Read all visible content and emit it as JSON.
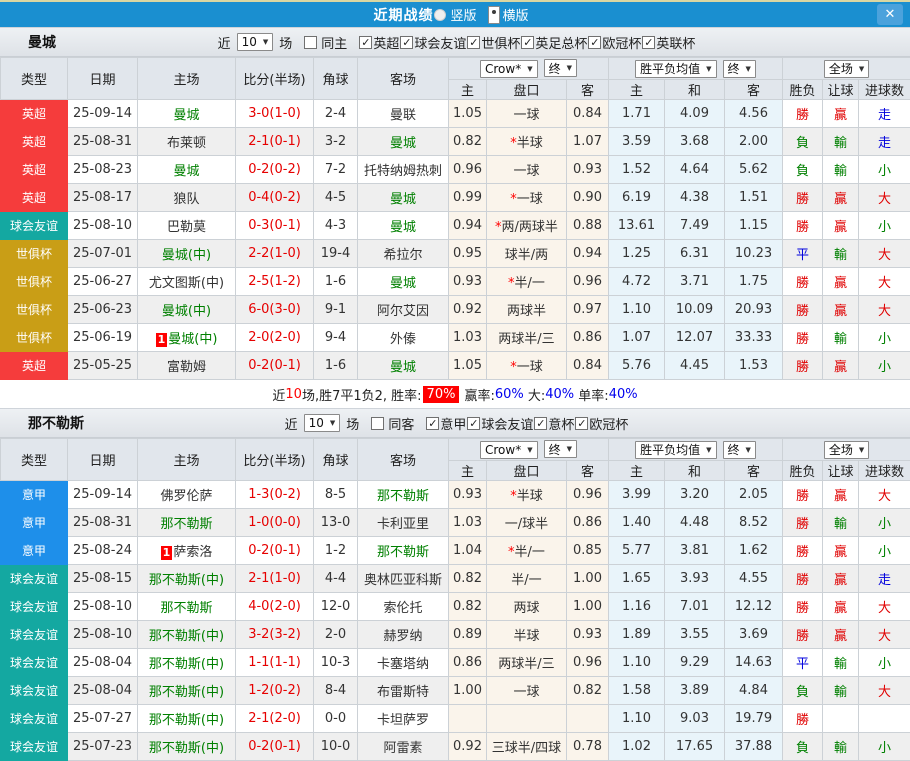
{
  "titlebar": {
    "title": "近期战绩",
    "radios": [
      {
        "label": "竖版",
        "selected": false
      },
      {
        "label": "横版",
        "selected": true
      }
    ],
    "close_label": "✕"
  },
  "table_header": {
    "left": [
      "类型",
      "日期",
      "主场",
      "比分(半场)",
      "角球",
      "客场"
    ],
    "dropdowns": {
      "crow": "Crow*",
      "final1": "终",
      "avg": "胜平负均值",
      "final2": "终",
      "scope": "全场"
    },
    "sub": [
      "主",
      "盘口",
      "客",
      "主",
      "和",
      "客",
      "胜负",
      "让球",
      "进球数"
    ]
  },
  "colors": {
    "accent_blue": "#1a8fd0",
    "type_epl": "#f53c3c",
    "type_friendly": "#14a8a1",
    "type_cwc": "#c99e16",
    "type_seriea": "#1e8fea",
    "win_red": "#e00000",
    "lose_green": "#008000",
    "draw_blue": "#0000dd"
  },
  "sections": [
    {
      "team": "曼城",
      "filter": {
        "near": "近",
        "count": "10",
        "games": "场",
        "same": {
          "label": "同主",
          "checked": false
        },
        "leagues": [
          {
            "label": "英超",
            "checked": true
          },
          {
            "label": "球会友谊",
            "checked": true
          },
          {
            "label": "世俱杯",
            "checked": true
          },
          {
            "label": "英足总杯",
            "checked": true
          },
          {
            "label": "欧冠杯",
            "checked": true
          },
          {
            "label": "英联杯",
            "checked": true
          }
        ]
      },
      "rows": [
        {
          "type": "英超",
          "type_c": "epl",
          "date": "25-09-14",
          "home": "曼城",
          "home_green": true,
          "home_badge": false,
          "score": "3-0",
          "half": "(1-0)",
          "corners": "2-4",
          "away": "曼联",
          "away_green": false,
          "o_home": "1.05",
          "h_star": false,
          "handicap": "一球",
          "o_away": "0.84",
          "avg_home": "1.71",
          "avg_draw": "4.09",
          "avg_away": "4.56",
          "res_wdl": "勝",
          "res_handicap": "贏",
          "res_goals": "走"
        },
        {
          "type": "英超",
          "type_c": "epl",
          "date": "25-08-31",
          "home": "布莱顿",
          "home_green": false,
          "home_badge": false,
          "score": "2-1",
          "half": "(0-1)",
          "corners": "3-2",
          "away": "曼城",
          "away_green": true,
          "o_home": "0.82",
          "h_star": true,
          "handicap": "半球",
          "o_away": "1.07",
          "avg_home": "3.59",
          "avg_draw": "3.68",
          "avg_away": "2.00",
          "res_wdl": "負",
          "res_handicap": "輸",
          "res_goals": "走"
        },
        {
          "type": "英超",
          "type_c": "epl",
          "date": "25-08-23",
          "home": "曼城",
          "home_green": true,
          "home_badge": false,
          "score": "0-2",
          "half": "(0-2)",
          "corners": "7-2",
          "away": "托特纳姆热刺",
          "away_green": false,
          "o_home": "0.96",
          "h_star": false,
          "handicap": "一球",
          "o_away": "0.93",
          "avg_home": "1.52",
          "avg_draw": "4.64",
          "avg_away": "5.62",
          "res_wdl": "負",
          "res_handicap": "輸",
          "res_goals": "小"
        },
        {
          "type": "英超",
          "type_c": "epl",
          "date": "25-08-17",
          "home": "狼队",
          "home_green": false,
          "home_badge": false,
          "score": "0-4",
          "half": "(0-2)",
          "corners": "4-5",
          "away": "曼城",
          "away_green": true,
          "o_home": "0.99",
          "h_star": true,
          "handicap": "一球",
          "o_away": "0.90",
          "avg_home": "6.19",
          "avg_draw": "4.38",
          "avg_away": "1.51",
          "res_wdl": "勝",
          "res_handicap": "贏",
          "res_goals": "大"
        },
        {
          "type": "球会友谊",
          "type_c": "friendly",
          "date": "25-08-10",
          "home": "巴勒莫",
          "home_green": false,
          "home_badge": false,
          "score": "0-3",
          "half": "(0-1)",
          "corners": "4-3",
          "away": "曼城",
          "away_green": true,
          "o_home": "0.94",
          "h_star": true,
          "handicap": "两/两球半",
          "o_away": "0.88",
          "avg_home": "13.61",
          "avg_draw": "7.49",
          "avg_away": "1.15",
          "res_wdl": "勝",
          "res_handicap": "贏",
          "res_goals": "小"
        },
        {
          "type": "世俱杯",
          "type_c": "cwc",
          "date": "25-07-01",
          "home": "曼城(中)",
          "home_green": true,
          "home_badge": false,
          "score": "2-2",
          "half": "(1-0)",
          "corners": "19-4",
          "away": "希拉尔",
          "away_green": false,
          "o_home": "0.95",
          "h_star": false,
          "handicap": "球半/两",
          "o_away": "0.94",
          "avg_home": "1.25",
          "avg_draw": "6.31",
          "avg_away": "10.23",
          "res_wdl": "平",
          "res_handicap": "輸",
          "res_goals": "大"
        },
        {
          "type": "世俱杯",
          "type_c": "cwc",
          "date": "25-06-27",
          "home": "尤文图斯(中)",
          "home_green": false,
          "home_badge": false,
          "score": "2-5",
          "half": "(1-2)",
          "corners": "1-6",
          "away": "曼城",
          "away_green": true,
          "o_home": "0.93",
          "h_star": true,
          "handicap": "半/一",
          "o_away": "0.96",
          "avg_home": "4.72",
          "avg_draw": "3.71",
          "avg_away": "1.75",
          "res_wdl": "勝",
          "res_handicap": "贏",
          "res_goals": "大"
        },
        {
          "type": "世俱杯",
          "type_c": "cwc",
          "date": "25-06-23",
          "home": "曼城(中)",
          "home_green": true,
          "home_badge": false,
          "score": "6-0",
          "half": "(3-0)",
          "corners": "9-1",
          "away": "阿尔艾因",
          "away_green": false,
          "o_home": "0.92",
          "h_star": false,
          "handicap": "两球半",
          "o_away": "0.97",
          "avg_home": "1.10",
          "avg_draw": "10.09",
          "avg_away": "20.93",
          "res_wdl": "勝",
          "res_handicap": "贏",
          "res_goals": "大"
        },
        {
          "type": "世俱杯",
          "type_c": "cwc",
          "date": "25-06-19",
          "home": "曼城(中)",
          "home_green": true,
          "home_badge": true,
          "score": "2-0",
          "half": "(2-0)",
          "corners": "9-4",
          "away": "外傣",
          "away_green": false,
          "o_home": "1.03",
          "h_star": false,
          "handicap": "两球半/三",
          "o_away": "0.86",
          "avg_home": "1.07",
          "avg_draw": "12.07",
          "avg_away": "33.33",
          "res_wdl": "勝",
          "res_handicap": "輸",
          "res_goals": "小"
        },
        {
          "type": "英超",
          "type_c": "epl",
          "date": "25-05-25",
          "home": "富勒姆",
          "home_green": false,
          "home_badge": false,
          "score": "0-2",
          "half": "(0-1)",
          "corners": "1-6",
          "away": "曼城",
          "away_green": true,
          "o_home": "1.05",
          "h_star": true,
          "handicap": "一球",
          "o_away": "0.84",
          "avg_home": "5.76",
          "avg_draw": "4.45",
          "avg_away": "1.53",
          "res_wdl": "勝",
          "res_handicap": "贏",
          "res_goals": "小"
        }
      ],
      "summary": {
        "near": "近",
        "count": "10",
        "mid": "场,胜7平1负2, 胜率:",
        "rate_badge": "70%",
        "stats": [
          {
            "label": "赢率:",
            "value": "60%"
          },
          {
            "label": "大:",
            "value": "40%"
          },
          {
            "label": "单率:",
            "value": "40%"
          }
        ]
      }
    },
    {
      "team": "那不勒斯",
      "filter": {
        "near": "近",
        "count": "10",
        "games": "场",
        "same": {
          "label": "同客",
          "checked": false
        },
        "leagues": [
          {
            "label": "意甲",
            "checked": true
          },
          {
            "label": "球会友谊",
            "checked": true
          },
          {
            "label": "意杯",
            "checked": true
          },
          {
            "label": "欧冠杯",
            "checked": true
          }
        ]
      },
      "rows": [
        {
          "type": "意甲",
          "type_c": "seriea",
          "date": "25-09-14",
          "home": "佛罗伦萨",
          "home_green": false,
          "home_badge": false,
          "score": "1-3",
          "half": "(0-2)",
          "corners": "8-5",
          "away": "那不勒斯",
          "away_green": true,
          "o_home": "0.93",
          "h_star": true,
          "handicap": "半球",
          "o_away": "0.96",
          "avg_home": "3.99",
          "avg_draw": "3.20",
          "avg_away": "2.05",
          "res_wdl": "勝",
          "res_handicap": "贏",
          "res_goals": "大"
        },
        {
          "type": "意甲",
          "type_c": "seriea",
          "date": "25-08-31",
          "home": "那不勒斯",
          "home_green": true,
          "home_badge": false,
          "score": "1-0",
          "half": "(0-0)",
          "corners": "13-0",
          "away": "卡利亚里",
          "away_green": false,
          "o_home": "1.03",
          "h_star": false,
          "handicap": "一/球半",
          "o_away": "0.86",
          "avg_home": "1.40",
          "avg_draw": "4.48",
          "avg_away": "8.52",
          "res_wdl": "勝",
          "res_handicap": "輸",
          "res_goals": "小"
        },
        {
          "type": "意甲",
          "type_c": "seriea",
          "date": "25-08-24",
          "home": "萨索洛",
          "home_green": false,
          "home_badge": true,
          "score": "0-2",
          "half": "(0-1)",
          "corners": "1-2",
          "away": "那不勒斯",
          "away_green": true,
          "o_home": "1.04",
          "h_star": true,
          "handicap": "半/一",
          "o_away": "0.85",
          "avg_home": "5.77",
          "avg_draw": "3.81",
          "avg_away": "1.62",
          "res_wdl": "勝",
          "res_handicap": "贏",
          "res_goals": "小"
        },
        {
          "type": "球会友谊",
          "type_c": "friendly",
          "date": "25-08-15",
          "home": "那不勒斯(中)",
          "home_green": true,
          "home_badge": false,
          "score": "2-1",
          "half": "(1-0)",
          "corners": "4-4",
          "away": "奥林匹亚科斯",
          "away_green": false,
          "o_home": "0.82",
          "h_star": false,
          "handicap": "半/一",
          "o_away": "1.00",
          "avg_home": "1.65",
          "avg_draw": "3.93",
          "avg_away": "4.55",
          "res_wdl": "勝",
          "res_handicap": "贏",
          "res_goals": "走"
        },
        {
          "type": "球会友谊",
          "type_c": "friendly",
          "date": "25-08-10",
          "home": "那不勒斯",
          "home_green": true,
          "home_badge": false,
          "score": "4-0",
          "half": "(2-0)",
          "corners": "12-0",
          "away": "索伦托",
          "away_green": false,
          "o_home": "0.82",
          "h_star": false,
          "handicap": "两球",
          "o_away": "1.00",
          "avg_home": "1.16",
          "avg_draw": "7.01",
          "avg_away": "12.12",
          "res_wdl": "勝",
          "res_handicap": "贏",
          "res_goals": "大"
        },
        {
          "type": "球会友谊",
          "type_c": "friendly",
          "date": "25-08-10",
          "home": "那不勒斯(中)",
          "home_green": true,
          "home_badge": false,
          "score": "3-2",
          "half": "(3-2)",
          "corners": "2-0",
          "away": "赫罗纳",
          "away_green": false,
          "o_home": "0.89",
          "h_star": false,
          "handicap": "半球",
          "o_away": "0.93",
          "avg_home": "1.89",
          "avg_draw": "3.55",
          "avg_away": "3.69",
          "res_wdl": "勝",
          "res_handicap": "贏",
          "res_goals": "大"
        },
        {
          "type": "球会友谊",
          "type_c": "friendly",
          "date": "25-08-04",
          "home": "那不勒斯(中)",
          "home_green": true,
          "home_badge": false,
          "score": "1-1",
          "half": "(1-1)",
          "corners": "10-3",
          "away": "卡塞塔纳",
          "away_green": false,
          "o_home": "0.86",
          "h_star": false,
          "handicap": "两球半/三",
          "o_away": "0.96",
          "avg_home": "1.10",
          "avg_draw": "9.29",
          "avg_away": "14.63",
          "res_wdl": "平",
          "res_handicap": "輸",
          "res_goals": "小"
        },
        {
          "type": "球会友谊",
          "type_c": "friendly",
          "date": "25-08-04",
          "home": "那不勒斯(中)",
          "home_green": true,
          "home_badge": false,
          "score": "1-2",
          "half": "(0-2)",
          "corners": "8-4",
          "away": "布雷斯特",
          "away_green": false,
          "o_home": "1.00",
          "h_star": false,
          "handicap": "一球",
          "o_away": "0.82",
          "avg_home": "1.58",
          "avg_draw": "3.89",
          "avg_away": "4.84",
          "res_wdl": "負",
          "res_handicap": "輸",
          "res_goals": "大"
        },
        {
          "type": "球会友谊",
          "type_c": "friendly",
          "date": "25-07-27",
          "home": "那不勒斯(中)",
          "home_green": true,
          "home_badge": false,
          "score": "2-1",
          "half": "(2-0)",
          "corners": "0-0",
          "away": "卡坦萨罗",
          "away_green": false,
          "o_home": "",
          "h_star": false,
          "handicap": "",
          "o_away": "",
          "avg_home": "1.10",
          "avg_draw": "9.03",
          "avg_away": "19.79",
          "res_wdl": "勝",
          "res_handicap": "",
          "res_goals": ""
        },
        {
          "type": "球会友谊",
          "type_c": "friendly",
          "date": "25-07-23",
          "home": "那不勒斯(中)",
          "home_green": true,
          "home_badge": false,
          "score": "0-2",
          "half": "(0-1)",
          "corners": "10-0",
          "away": "阿雷素",
          "away_green": false,
          "o_home": "0.92",
          "h_star": false,
          "handicap": "三球半/四球",
          "o_away": "0.78",
          "avg_home": "1.02",
          "avg_draw": "17.65",
          "avg_away": "37.88",
          "res_wdl": "負",
          "res_handicap": "輸",
          "res_goals": "小"
        }
      ],
      "summary": null
    }
  ]
}
